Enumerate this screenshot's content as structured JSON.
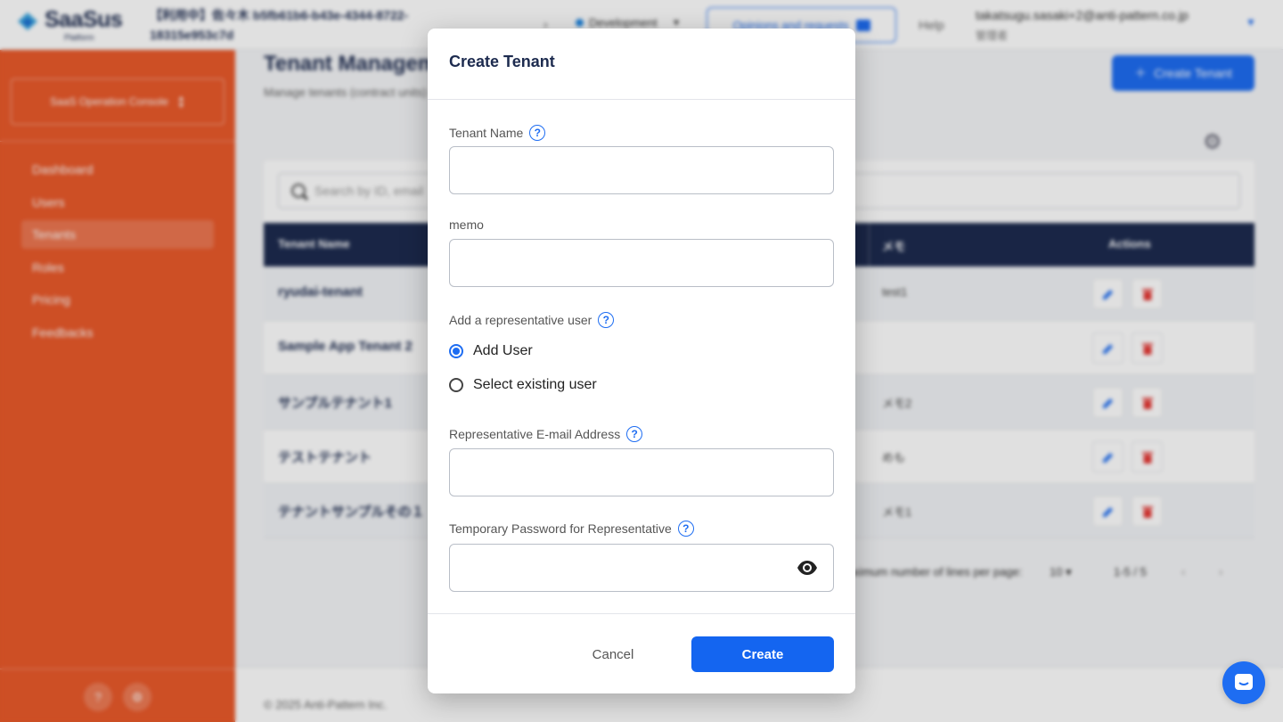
{
  "header": {
    "logo_text": "SaaSus",
    "logo_sub": "Platform",
    "environment_title": "【利用中】佐々木 b5fb61b6-b43e-4344-8722-18315e953c7d",
    "env_selector": "Development",
    "opinion_button": "Opinions and requests",
    "help": "Help",
    "user_email": "takatsugu.sasaki+2@anti-pattern.co.jp",
    "user_role": "管理者"
  },
  "sidebar": {
    "console_selector": "SaaS Operation Console",
    "items": [
      {
        "label": "Dashboard"
      },
      {
        "label": "Users"
      },
      {
        "label": "Tenants"
      },
      {
        "label": "Roles"
      },
      {
        "label": "Pricing"
      },
      {
        "label": "Feedbacks"
      }
    ]
  },
  "page": {
    "title": "Tenant Management",
    "subtitle": "Manage tenants (contract units)",
    "create_button": "Create Tenant",
    "search_placeholder": "Search by ID, email",
    "columns": {
      "name": "Tenant Name",
      "memo": "メモ",
      "actions": "Actions"
    },
    "rows": [
      {
        "name": "ryudai-tenant",
        "memo": "test1"
      },
      {
        "name": "Sample App Tenant 2",
        "memo": ""
      },
      {
        "name": "サンプルテナント1",
        "memo": "メモ2"
      },
      {
        "name": "テストテナント",
        "memo": "めも"
      },
      {
        "name": "テナントサンプルその１",
        "memo": "メモ1"
      }
    ],
    "pagination": {
      "rows_label": "Maximum number of lines per page:",
      "rows_value": "10",
      "range": "1-5 / 5"
    },
    "copyright": "© 2025 Anti-Pattern Inc."
  },
  "modal": {
    "title": "Create Tenant",
    "tenant_name_label": "Tenant Name",
    "tenant_name_value": "",
    "memo_label": "memo",
    "memo_value": "",
    "rep_user_label": "Add a representative user",
    "radio_add_user": "Add User",
    "radio_existing_user": "Select existing user",
    "selected_option": "Add User",
    "email_label": "Representative E-mail Address",
    "email_value": "",
    "password_label": "Temporary Password for Representative",
    "password_value": "",
    "cancel": "Cancel",
    "create": "Create"
  },
  "colors": {
    "sidebar": "#ea5a2b",
    "primary": "#1e6df2",
    "navy": "#1d2b4f",
    "danger": "#e53935"
  }
}
